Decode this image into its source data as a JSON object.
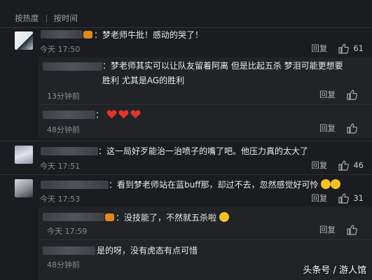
{
  "sort": {
    "hot": "按热度",
    "time": "按时间"
  },
  "actions": {
    "reply": "回复"
  },
  "comments": [
    {
      "text": "：梦老师牛批！感动的哭了！",
      "time": "今天 17:50",
      "likes": "61",
      "replies": [
        {
          "text": "：梦老师其实可以让队友留着阿离 但是比起五杀 梦泪可能更想要胜利 尤其是AG的胜利",
          "time": "13分钟前"
        },
        {
          "text": "：",
          "time": "48分钟前"
        }
      ]
    },
    {
      "text": "：这一局好歹能治一治喷子的嘴了吧。他压力真的太大了",
      "time": "今天 17:51",
      "likes": "46",
      "replies": []
    },
    {
      "text": "：看到梦老师站在蓝buff那，却过不去，忽然感觉好可怜",
      "time": "今天 17:53",
      "likes": "31",
      "replies": [
        {
          "text": "：没技能了，不然就五杀啦",
          "time": "今天 17:59"
        },
        {
          "text": "是的呀，没有虎态有点可惜",
          "time": "48分钟前"
        }
      ]
    }
  ],
  "watermark": "头条号 / 游人馆",
  "colors": {
    "bg": "#1b1c20",
    "reply_bg": "#222327",
    "badge": "#e38a1c",
    "heart": "#e0352b"
  }
}
